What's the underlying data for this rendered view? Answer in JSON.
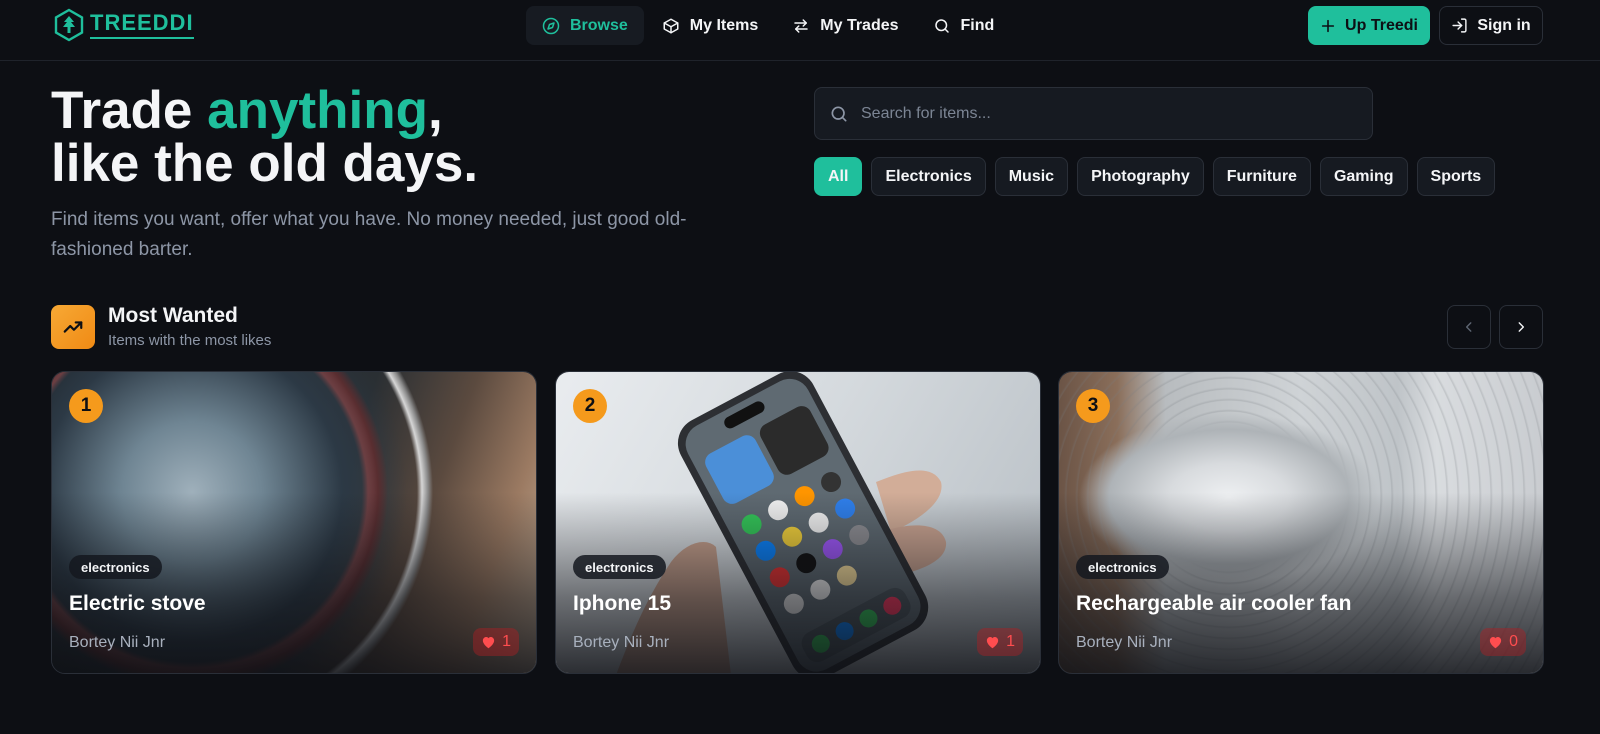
{
  "brand": {
    "name": "TREEDDI",
    "accent": "#1fbf9c"
  },
  "nav": {
    "items": [
      {
        "label": "Browse",
        "icon": "compass-icon",
        "active": true
      },
      {
        "label": "My Items",
        "icon": "box-icon",
        "active": false
      },
      {
        "label": "My Trades",
        "icon": "swap-icon",
        "active": false
      },
      {
        "label": "Find",
        "icon": "search-icon",
        "active": false
      }
    ],
    "up_button": "Up Treedi",
    "signin_button": "Sign in"
  },
  "hero": {
    "title_part1": "Trade ",
    "title_accent": "anything",
    "title_part2": ",",
    "title_line2": "like the old days.",
    "subtitle": "Find items you want, offer what you have. No money needed, just good old-fashioned barter."
  },
  "search": {
    "placeholder": "Search for items...",
    "value": ""
  },
  "categories": [
    "All",
    "Electronics",
    "Music",
    "Photography",
    "Furniture",
    "Gaming",
    "Sports"
  ],
  "section": {
    "title": "Most Wanted",
    "subtitle": "Items with the most likes",
    "accent": "#f59a1c"
  },
  "cards": [
    {
      "rank": "1",
      "category": "electronics",
      "title": "Electric stove",
      "owner": "Bortey Nii Jnr",
      "likes": "1"
    },
    {
      "rank": "2",
      "category": "electronics",
      "title": "Iphone 15",
      "owner": "Bortey Nii Jnr",
      "likes": "1"
    },
    {
      "rank": "3",
      "category": "electronics",
      "title": "Rechargeable air cooler fan",
      "owner": "Bortey Nii Jnr",
      "likes": "0"
    }
  ]
}
